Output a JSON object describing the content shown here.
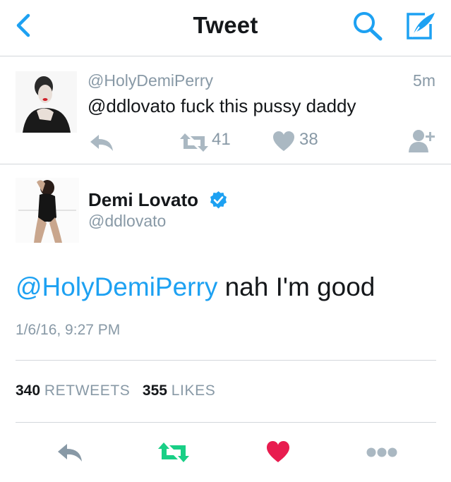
{
  "nav": {
    "title": "Tweet",
    "back_icon": "chevron-left-icon",
    "search_icon": "search-icon",
    "compose_icon": "compose-icon",
    "accent": "#1da1f2"
  },
  "reply_tweet": {
    "handle": "@HolyDemiPerry",
    "time": "5m",
    "text": "@ddlovato fuck this pussy daddy",
    "retweet_count": "41",
    "like_count": "38"
  },
  "main_tweet": {
    "name": "Demi Lovato",
    "handle": "@ddlovato",
    "mention": "@HolyDemiPerry",
    "text": " nah I'm good",
    "timestamp": "1/6/16, 9:27 PM",
    "retweets_count": "340",
    "retweets_label": "RETWEETS",
    "likes_count": "355",
    "likes_label": "LIKES"
  },
  "colors": {
    "text": "#14171a",
    "muted": "#8899a6",
    "link": "#1da1f2",
    "retweet_green": "#19cf86",
    "like_red": "#e81c4f",
    "divider": "#d3d7db"
  }
}
